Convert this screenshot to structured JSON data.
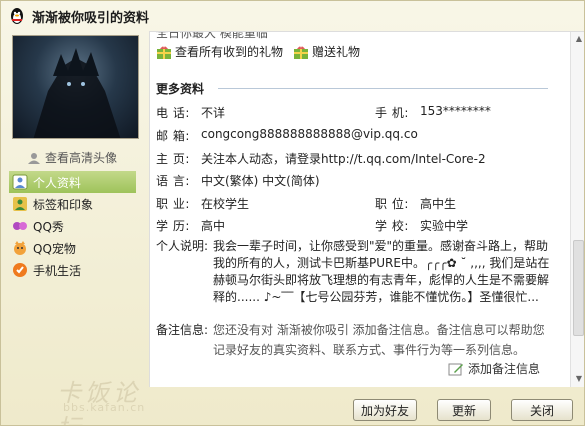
{
  "window": {
    "title": "渐渐被你吸引的资料"
  },
  "gifts": {
    "view_all": "查看所有收到的礼物",
    "send": "赠送礼物",
    "clipped_top": "全日你最大  模能重临"
  },
  "avatar": {
    "hd_link": "查看高清头像"
  },
  "nav": {
    "items": [
      {
        "label": "个人资料",
        "icon": "user-icon",
        "active": true
      },
      {
        "label": "标签和印象",
        "icon": "tag-icon",
        "active": false
      },
      {
        "label": "QQ秀",
        "icon": "qqshow-icon",
        "active": false
      },
      {
        "label": "QQ宠物",
        "icon": "pet-icon",
        "active": false
      },
      {
        "label": "手机生活",
        "icon": "phone-icon",
        "active": false
      }
    ]
  },
  "section": {
    "more_info": "更多资料"
  },
  "fields": {
    "phone_label": "电  话:",
    "phone_value": "不详",
    "mobile_label": "手  机:",
    "mobile_value": "153********",
    "email_label": "邮  箱:",
    "email_value": "congcong888888888888@vip.qq.co",
    "homepage_label": "主  页:",
    "homepage_value": "关注本人动态，请登录http://t.qq.com/Intel-Core-2",
    "language_label": "语  言:",
    "language_value": "中文(繁体)  中文(简体)",
    "job_label": "职  业:",
    "job_value": "在校学生",
    "position_label": "职  位:",
    "position_value": "高中生",
    "education_label": "学  历:",
    "education_value": "高中",
    "school_label": "学  校:",
    "school_value": "实验中学"
  },
  "intro": {
    "label": "个人说明:",
    "line1": "我会一辈子时间，让你感受到\"爱\"的重量。感谢奋斗路上，帮助",
    "line2": "我的所有的人，测试卡巴斯基PURE中。╭╭╭✿ ˘ ,,,, 我们是站在",
    "line3": "赫顿马尔街头即将放飞理想的有志青年，彪悍的人生是不需要解",
    "line4": "释的...... ♪~‾‾【七号公园芬芳，谁能不懂忧伤。】圣懂很忙..."
  },
  "remark": {
    "label": "备注信息:",
    "line1": "您还没有对 渐渐被你吸引 添加备注信息。备注信息可以帮助您",
    "line2": "记录好友的真实资料、联系方式、事件行为等一系列信息。",
    "add": "添加备注信息"
  },
  "footer": {
    "add_friend": "加为好友",
    "refresh": "更新",
    "close": "关闭"
  },
  "watermark": {
    "main": "卡饭论坛",
    "sub": "bbs.kafan.cn"
  }
}
